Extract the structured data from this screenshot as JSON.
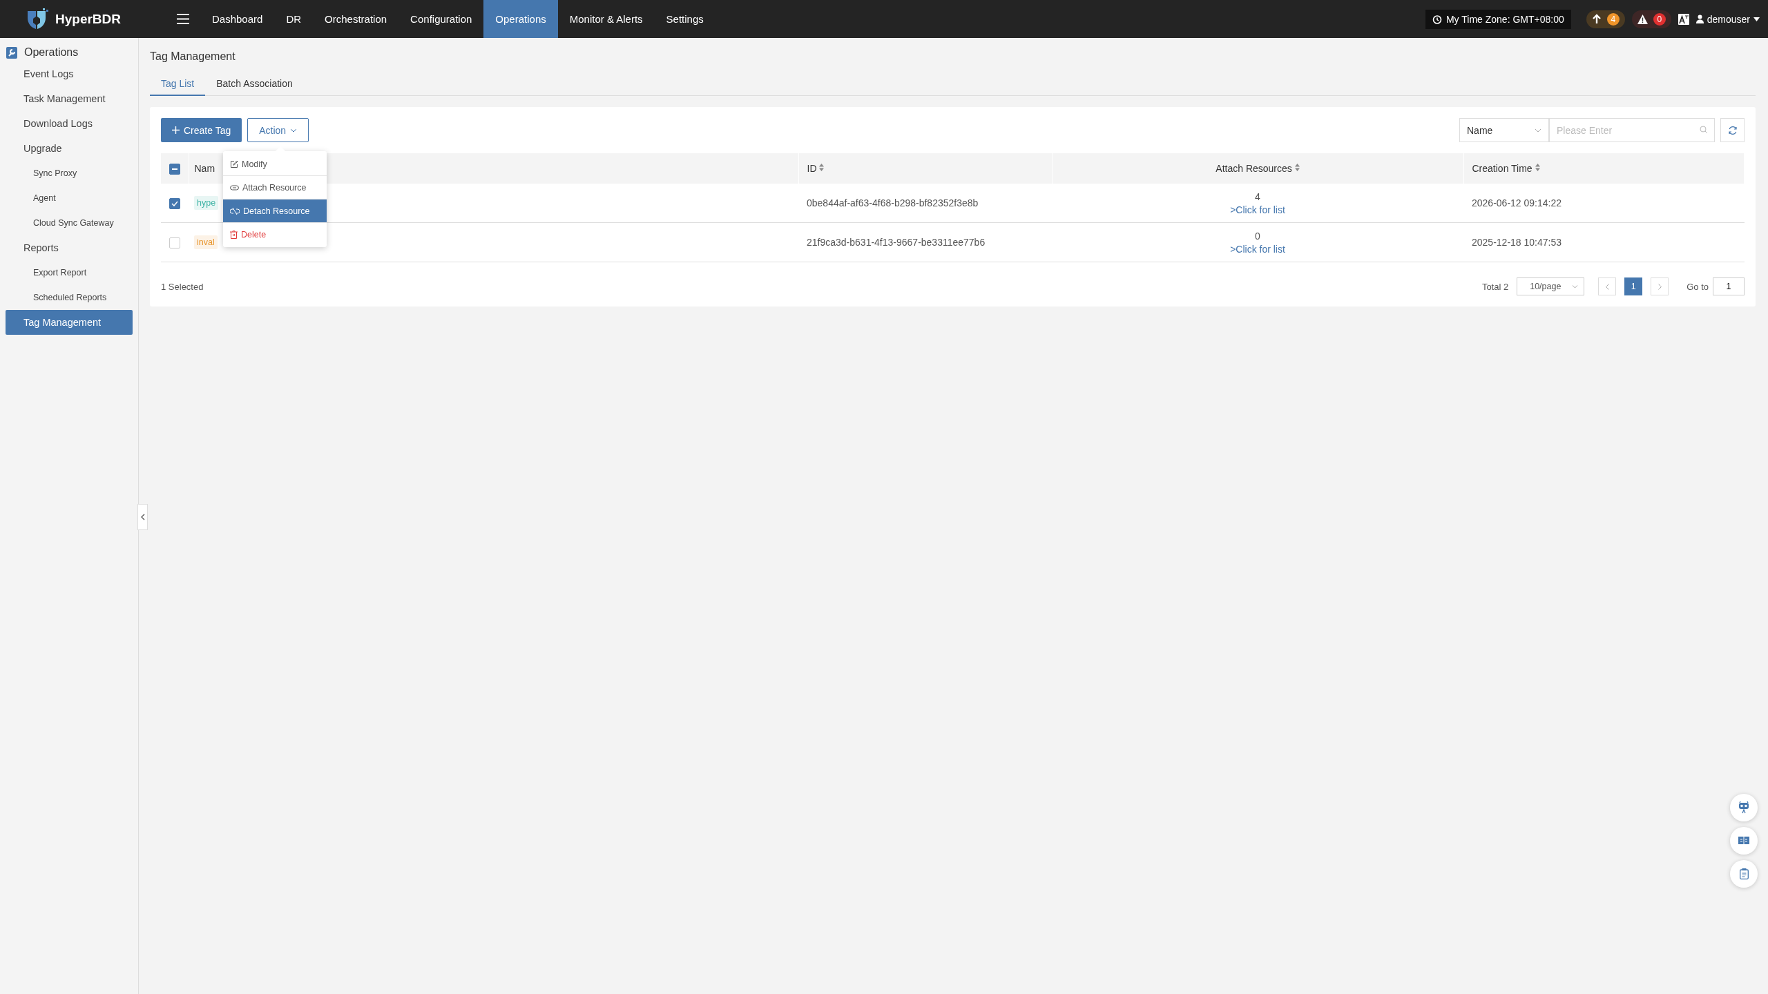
{
  "header": {
    "brand": "HyperBDR",
    "nav": [
      {
        "label": "Dashboard",
        "selected": false
      },
      {
        "label": "DR",
        "selected": false
      },
      {
        "label": "Orchestration",
        "selected": false
      },
      {
        "label": "Configuration",
        "selected": false
      },
      {
        "label": "Operations",
        "selected": true
      },
      {
        "label": "Monitor & Alerts",
        "selected": false
      },
      {
        "label": "Settings",
        "selected": false
      }
    ],
    "timezone": "My Time Zone: GMT+08:00",
    "upgrades": "4",
    "alerts": "0",
    "user": "demouser"
  },
  "sidebar": {
    "title": "Operations",
    "items": [
      {
        "label": "Event Logs",
        "selected": false
      },
      {
        "label": "Task Management",
        "selected": false
      },
      {
        "label": "Download Logs",
        "selected": false
      },
      {
        "label": "Upgrade",
        "selected": false,
        "children": [
          {
            "label": "Sync Proxy",
            "selected": false
          },
          {
            "label": "Agent",
            "selected": false
          },
          {
            "label": "Cloud Sync Gateway",
            "selected": false
          }
        ]
      },
      {
        "label": "Reports",
        "selected": false,
        "children": [
          {
            "label": "Export Report",
            "selected": false
          },
          {
            "label": "Scheduled Reports",
            "selected": false
          }
        ]
      },
      {
        "label": "Tag Management",
        "selected": true
      }
    ]
  },
  "page": {
    "title": "Tag Management",
    "tabs": [
      {
        "label": "Tag List",
        "selected": true
      },
      {
        "label": "Batch Association",
        "selected": false
      }
    ],
    "toolbar": {
      "create": "Create Tag",
      "action": "Action",
      "filter_field": "Name",
      "search": {
        "placeholder": "Please Enter"
      }
    },
    "action_menu": [
      {
        "label": "Modify",
        "kind": "edit",
        "selected": false
      },
      {
        "label": "Attach Resource",
        "kind": "attach",
        "selected": false
      },
      {
        "label": "Detach Resource",
        "kind": "detach",
        "selected": true
      },
      {
        "label": "Delete",
        "kind": "delete",
        "selected": false
      }
    ],
    "table": {
      "columns": [
        "Nam",
        "ID",
        "Attach Resources",
        "Creation Time"
      ],
      "indeterminate": true,
      "rows": [
        {
          "checked": true,
          "name": "hype",
          "color": "#3fb3a5",
          "id": "0be844af-af63-4f68-b298-bf82352f3e8b",
          "count": "4",
          "link": ">Click for list",
          "created": "2026-06-12 09:14:22"
        },
        {
          "checked": false,
          "name": "inval",
          "color": "#e8962e",
          "id": "21f9ca3d-b631-4f13-9667-be3311ee77b6",
          "count": "0",
          "link": ">Click for list",
          "created": "2025-12-18 10:47:53"
        }
      ]
    },
    "footer": {
      "selected": "1 Selected",
      "total": "Total 2",
      "page_size": "10/page",
      "pages": [
        {
          "label": "1",
          "selected": true
        }
      ],
      "goto_label": "Go to",
      "goto_value": "1"
    }
  }
}
